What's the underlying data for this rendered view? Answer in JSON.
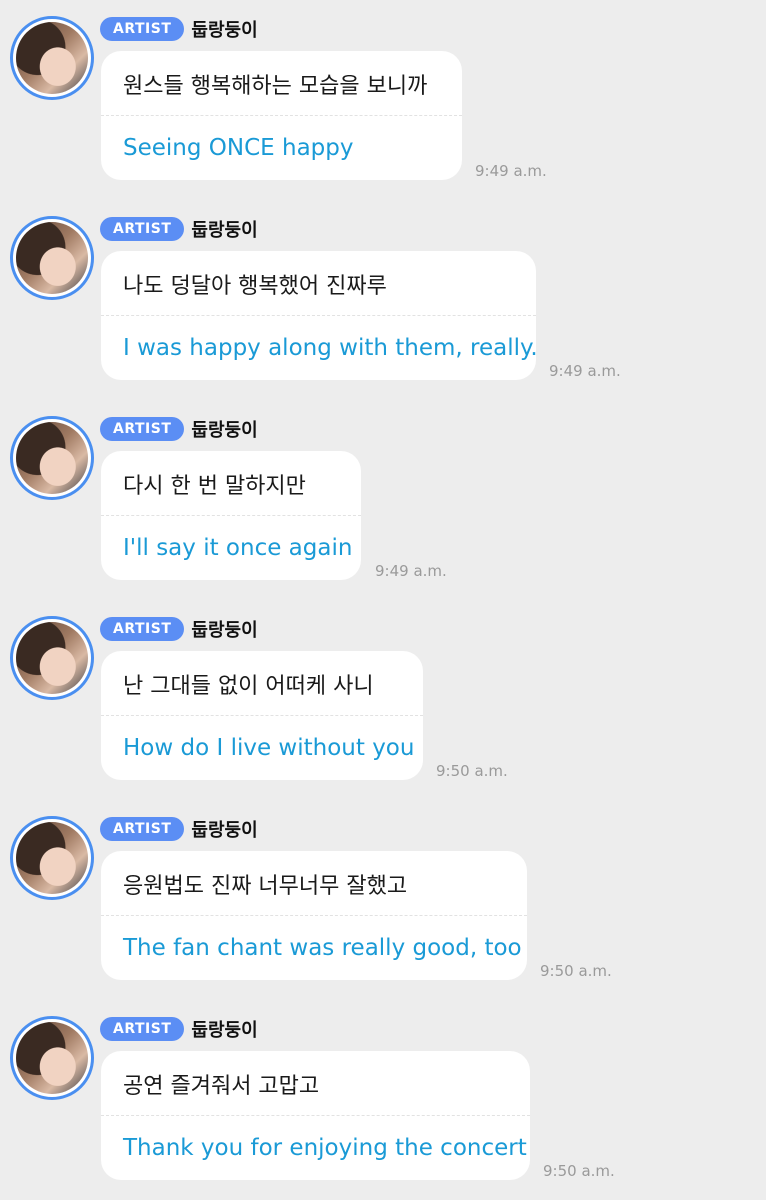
{
  "messages": [
    {
      "badge": "ARTIST",
      "name": "둡랑둥이",
      "korean": "원스들 행복해하는 모습을 보니까",
      "english": "Seeing ONCE happy",
      "time": "9:49 a.m."
    },
    {
      "badge": "ARTIST",
      "name": "둡랑둥이",
      "korean": "나도 덩달아 행복했어 진짜루",
      "english": "I was happy along with them, really.",
      "time": "9:49 a.m."
    },
    {
      "badge": "ARTIST",
      "name": "둡랑둥이",
      "korean": "다시 한 번 말하지만",
      "english": "I'll say it once again",
      "time": "9:49 a.m."
    },
    {
      "badge": "ARTIST",
      "name": "둡랑둥이",
      "korean": "난 그대들 없이 어떠케 사니",
      "english": "How do I live without you",
      "time": "9:50 a.m."
    },
    {
      "badge": "ARTIST",
      "name": "둡랑둥이",
      "korean": "응원법도 진짜 너무너무 잘했고",
      "english": "The fan chant was really good, too",
      "time": "9:50 a.m."
    },
    {
      "badge": "ARTIST",
      "name": "둡랑둥이",
      "korean": "공연 즐겨줘서 고맙고",
      "english": "Thank you for enjoying the concert",
      "time": "9:50 a.m."
    }
  ],
  "colors": {
    "background": "#ededed",
    "badge": "#5b8ef4",
    "translation": "#1a9ad6",
    "avatar_ring": "#4a8ff0"
  }
}
